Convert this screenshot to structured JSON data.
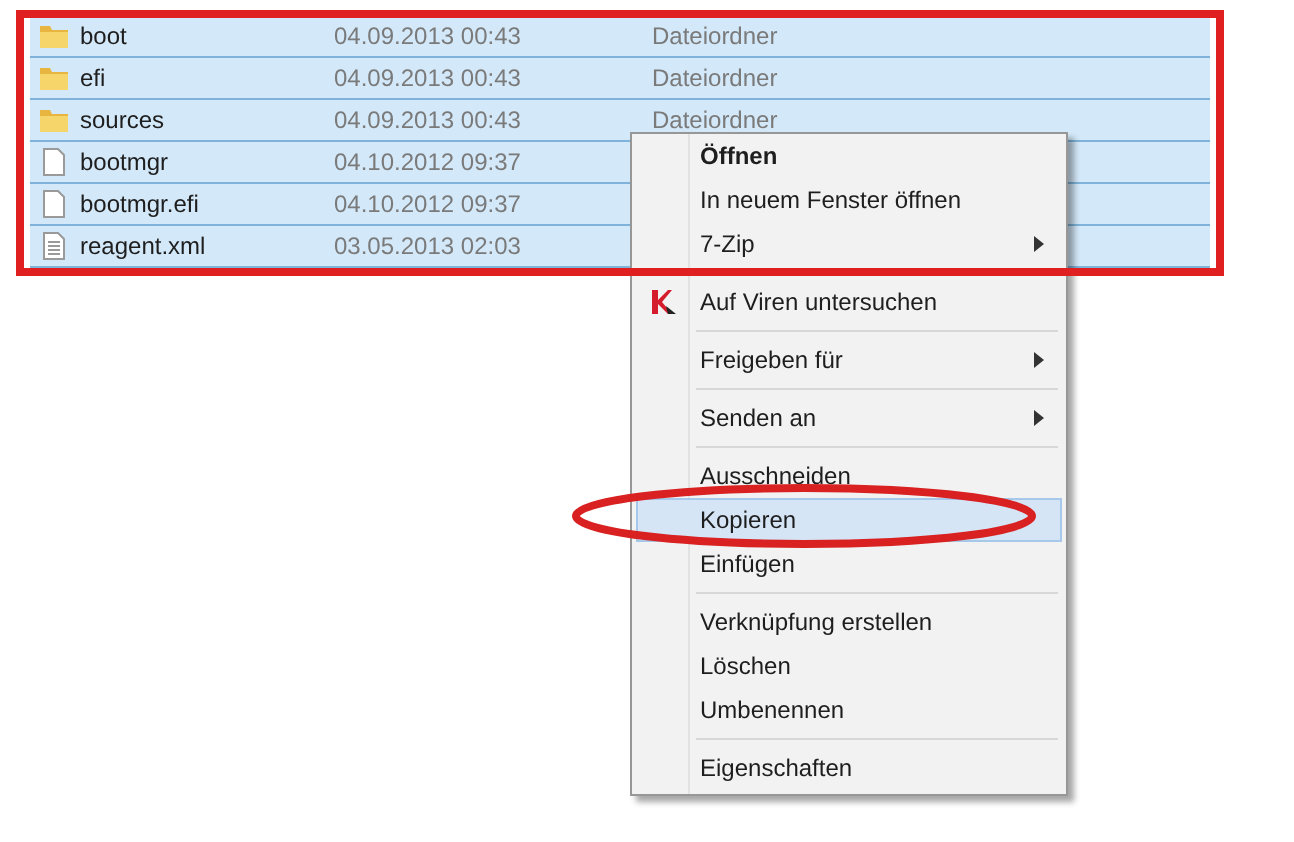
{
  "files": [
    {
      "name": "boot",
      "kind": "folder",
      "date": "04.09.2013 00:43",
      "type": "Dateiordner",
      "selected": true
    },
    {
      "name": "efi",
      "kind": "folder",
      "date": "04.09.2013 00:43",
      "type": "Dateiordner",
      "selected": true
    },
    {
      "name": "sources",
      "kind": "folder",
      "date": "04.09.2013 00:43",
      "type": "Dateiordner",
      "selected": true
    },
    {
      "name": "bootmgr",
      "kind": "file",
      "date": "04.10.2012 09:37",
      "selected": true
    },
    {
      "name": "bootmgr.efi",
      "kind": "file",
      "date": "04.10.2012 09:37",
      "selected": true
    },
    {
      "name": "reagent.xml",
      "kind": "text",
      "date": "03.05.2013 02:03",
      "selected": true
    }
  ],
  "context_menu": {
    "items": [
      {
        "kind": "item",
        "label": "Öffnen",
        "bold": true,
        "submenu": false,
        "selected": false
      },
      {
        "kind": "item",
        "label": "In neuem Fenster öffnen",
        "bold": false,
        "submenu": false,
        "selected": false
      },
      {
        "kind": "item",
        "label": "7-Zip",
        "bold": false,
        "submenu": true,
        "selected": false
      },
      {
        "kind": "separator"
      },
      {
        "kind": "icon_item",
        "label": "Auf Viren untersuchen",
        "bold": false,
        "submenu": false,
        "selected": false
      },
      {
        "kind": "separator"
      },
      {
        "kind": "item",
        "label": "Freigeben für",
        "bold": false,
        "submenu": true,
        "selected": false
      },
      {
        "kind": "separator"
      },
      {
        "kind": "item",
        "label": "Senden an",
        "bold": false,
        "submenu": true,
        "selected": false
      },
      {
        "kind": "separator"
      },
      {
        "kind": "item",
        "label": "Ausschneiden",
        "bold": false,
        "submenu": false,
        "selected": false
      },
      {
        "kind": "item",
        "label": "Kopieren",
        "bold": false,
        "submenu": false,
        "selected": true
      },
      {
        "kind": "item",
        "label": "Einfügen",
        "bold": false,
        "submenu": false,
        "selected": false
      },
      {
        "kind": "separator"
      },
      {
        "kind": "item",
        "label": "Verknüpfung erstellen",
        "bold": false,
        "submenu": false,
        "selected": false
      },
      {
        "kind": "item",
        "label": "Löschen",
        "bold": false,
        "submenu": false,
        "selected": false
      },
      {
        "kind": "item",
        "label": "Umbenennen",
        "bold": false,
        "submenu": false,
        "selected": false
      },
      {
        "kind": "separator"
      },
      {
        "kind": "item",
        "label": "Eigenschaften",
        "bold": false,
        "submenu": false,
        "selected": false
      }
    ]
  },
  "annotations": {
    "selection_box": true,
    "copy_circle": true
  }
}
